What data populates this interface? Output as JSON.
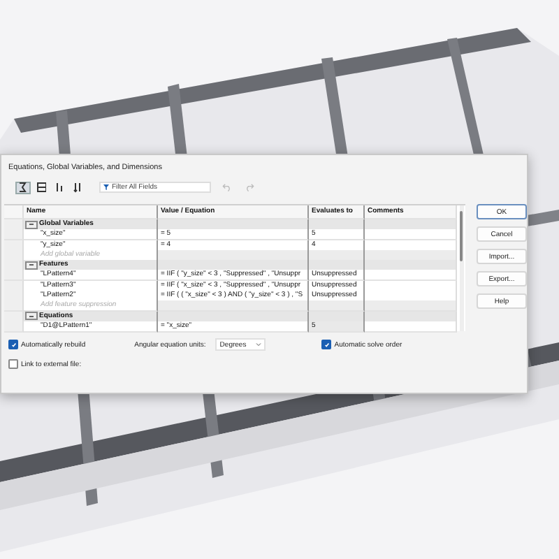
{
  "window": {
    "title": "Equations, Global Variables, and Dimensions"
  },
  "toolbar": {
    "view_modes": [
      {
        "selected": true
      },
      {
        "selected": false
      },
      {
        "selected": false
      },
      {
        "selected": false
      }
    ],
    "filter": {
      "placeholder": "Filter All Fields"
    },
    "undo": {
      "disabled": true
    },
    "redo": {
      "disabled": true
    }
  },
  "table": {
    "columns": [
      "Name",
      "Value / Equation",
      "Evaluates to",
      "Comments"
    ],
    "sections": [
      {
        "title": "Global Variables",
        "expanded": true,
        "add_placeholder": "Add global variable",
        "rows": [
          {
            "name": "\"x_size\"",
            "value": "= 5",
            "evaluates": "5"
          },
          {
            "name": "\"y_size\"",
            "value": "= 4",
            "evaluates": "4"
          }
        ]
      },
      {
        "title": "Features",
        "expanded": true,
        "add_placeholder": "Add feature suppression",
        "rows": [
          {
            "name": "\"LPattern4\"",
            "value": "= IIF ( \"y_size\" < 3 , \"Suppressed\" , \"Unsuppr",
            "evaluates": "Unsuppressed"
          },
          {
            "name": "\"LPattern3\"",
            "value": "= IIF ( \"x_size\" < 3 , \"Suppressed\" , \"Unsuppr",
            "evaluates": "Unsuppressed"
          },
          {
            "name": "\"LPattern2\"",
            "value": "= IIF ( ( \"x_size\" < 3 ) AND ( \"y_size\" < 3 ) , \"S",
            "evaluates": "Unsuppressed"
          }
        ]
      },
      {
        "title": "Equations",
        "expanded": true,
        "rows": [
          {
            "name": "\"D1@LPattern1\"",
            "value": "= \"x_size\"",
            "evaluates": "5"
          }
        ]
      }
    ]
  },
  "options": {
    "auto_rebuild": {
      "label": "Automatically rebuild",
      "checked": true
    },
    "angular_units": {
      "label": "Angular equation units:",
      "value": "Degrees"
    },
    "auto_solve": {
      "label": "Automatic solve order",
      "checked": true
    },
    "link_external": {
      "label": "Link to external file:",
      "checked": false
    }
  },
  "buttons": [
    "OK",
    "Cancel",
    "Import...",
    "Export...",
    "Help"
  ]
}
